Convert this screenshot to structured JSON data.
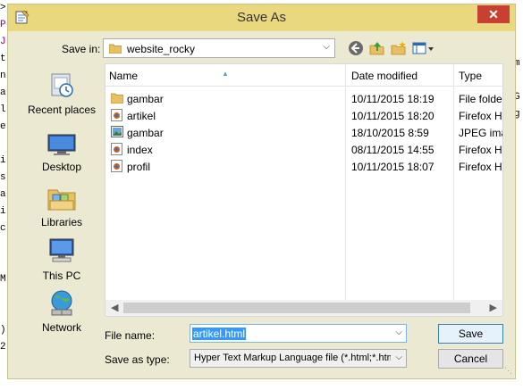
{
  "background_text": {
    "left": [
      ">",
      "P",
      "J",
      "t",
      "n",
      "a",
      "l",
      "e",
      "",
      "i",
      "s",
      "a",
      "i",
      "c",
      "",
      "",
      "M",
      "",
      "",
      ")",
      "2"
    ],
    "right": [
      "m",
      "",
      "G",
      "g",
      "",
      ""
    ]
  },
  "dialog": {
    "title": "Save As",
    "close_label": "✕"
  },
  "savein": {
    "label": "Save in:",
    "folder": "website_rocky"
  },
  "places": [
    {
      "label": "Recent places",
      "icon": "recent-places-icon"
    },
    {
      "label": "Desktop",
      "icon": "desktop-icon"
    },
    {
      "label": "Libraries",
      "icon": "libraries-icon"
    },
    {
      "label": "This PC",
      "icon": "this-pc-icon"
    },
    {
      "label": "Network",
      "icon": "network-icon"
    }
  ],
  "columns": {
    "name": "Name",
    "date": "Date modified",
    "type": "Type"
  },
  "files": [
    {
      "name": "gambar",
      "date": "10/11/2015 18:19",
      "type": "File folder",
      "icon": "folder-icon"
    },
    {
      "name": "artikel",
      "date": "10/11/2015 18:20",
      "type": "Firefox HT",
      "icon": "firefox-html-icon"
    },
    {
      "name": "gambar",
      "date": "18/10/2015 8:59",
      "type": "JPEG imag",
      "icon": "jpeg-image-icon"
    },
    {
      "name": "index",
      "date": "08/11/2015 14:55",
      "type": "Firefox HT",
      "icon": "firefox-html-icon"
    },
    {
      "name": "profil",
      "date": "10/11/2015 18:07",
      "type": "Firefox HT",
      "icon": "firefox-html-icon"
    }
  ],
  "filename": {
    "label": "File name:",
    "value": "artikel.html"
  },
  "savetype": {
    "label": "Save as type:",
    "value": "Hyper Text Markup Language file (*.html;*.htm;*"
  },
  "buttons": {
    "save": "Save",
    "cancel": "Cancel"
  },
  "colors": {
    "titlebar": "#e9d87e",
    "dialog_bg": "#ece9d3",
    "close": "#c84031",
    "selection": "#3399ff"
  }
}
